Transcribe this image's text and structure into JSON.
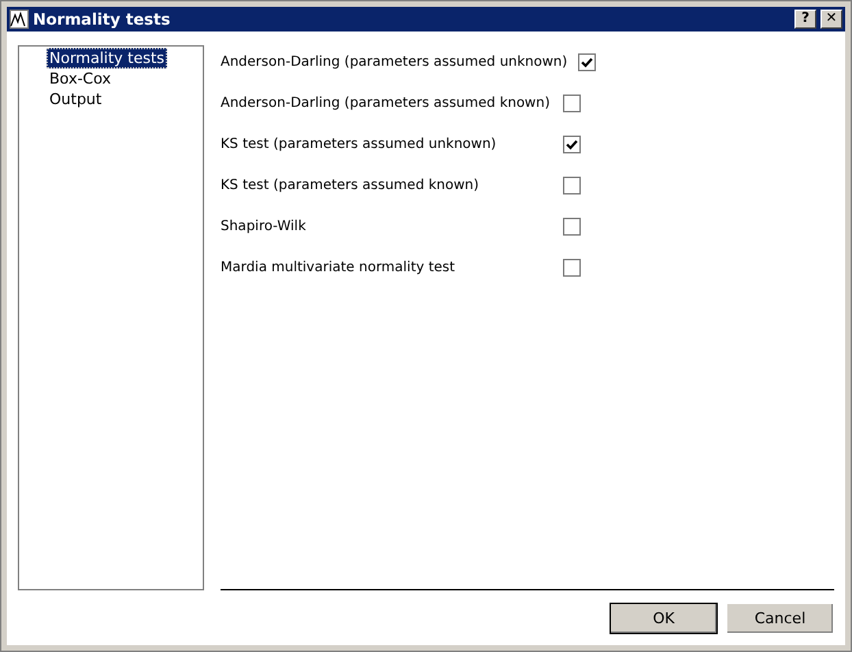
{
  "window": {
    "title": "Normality tests",
    "help_button": "?",
    "close_button": "✕"
  },
  "sidebar": {
    "items": [
      {
        "label": "Normality tests",
        "selected": true
      },
      {
        "label": "Box-Cox",
        "selected": false
      },
      {
        "label": "Output",
        "selected": false
      }
    ]
  },
  "options": [
    {
      "label": "Anderson-Darling (parameters assumed unknown)",
      "checked": true
    },
    {
      "label": "Anderson-Darling (parameters assumed known)",
      "checked": false
    },
    {
      "label": "KS test (parameters assumed unknown)",
      "checked": true
    },
    {
      "label": "KS test (parameters assumed known)",
      "checked": false
    },
    {
      "label": "Shapiro-Wilk",
      "checked": false
    },
    {
      "label": "Mardia multivariate normality test",
      "checked": false
    }
  ],
  "buttons": [
    "OK",
    "Cancel"
  ]
}
